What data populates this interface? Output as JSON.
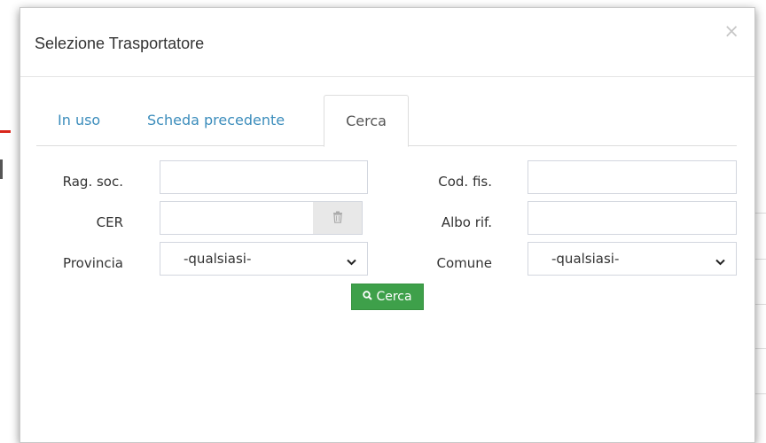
{
  "modal": {
    "title": "Selezione Trasportatore",
    "close_label": "×"
  },
  "tabs": [
    {
      "label": "In uso",
      "active": false
    },
    {
      "label": "Scheda precedente",
      "active": false
    },
    {
      "label": "Cerca",
      "active": true
    }
  ],
  "form": {
    "rag_soc_label": "Rag. soc.",
    "rag_soc_value": "",
    "cod_fis_label": "Cod. fis.",
    "cod_fis_value": "",
    "cer_label": "CER",
    "cer_value": "",
    "cer_clear_icon": "trash-icon",
    "albo_rif_label": "Albo rif.",
    "albo_rif_value": "",
    "provincia_label": "Provincia",
    "provincia_selected": "-qualsiasi-",
    "comune_label": "Comune",
    "comune_selected": "-qualsiasi-"
  },
  "search_button": {
    "label": "Cerca",
    "icon": "search-icon",
    "color": "#3ea04a"
  },
  "colors": {
    "tab_link": "#3c8dbc"
  }
}
